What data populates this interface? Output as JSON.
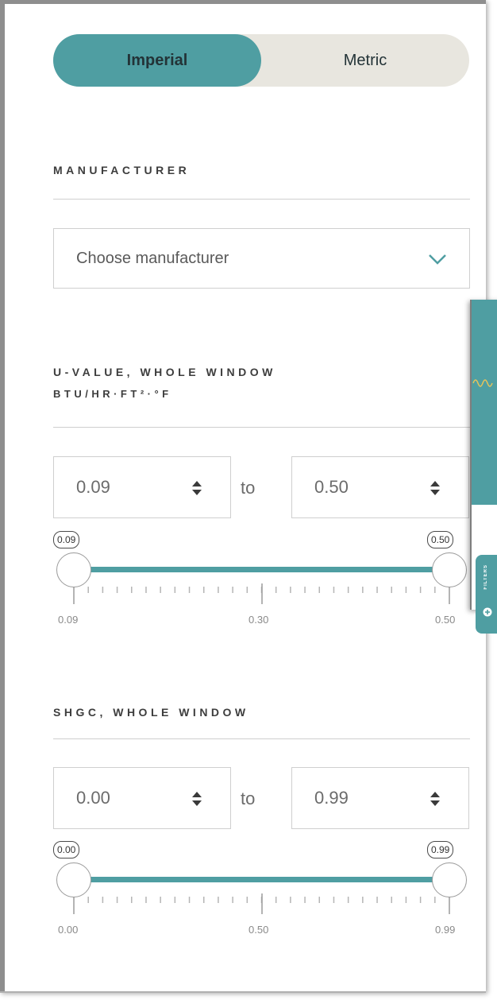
{
  "units_toggle": {
    "options": [
      "Imperial",
      "Metric"
    ],
    "selected": "Imperial"
  },
  "manufacturer": {
    "heading": "MANUFACTURER",
    "placeholder": "Choose manufacturer"
  },
  "u_value": {
    "heading_line1": "U-VALUE, WHOLE WINDOW",
    "heading_line2": "BTU/HR·FT²·°F",
    "min_input": "0.09",
    "to_word": "to",
    "max_input": "0.50",
    "bubble_min": "0.09",
    "bubble_max": "0.50",
    "scale_labels": [
      "0.09",
      "0.30",
      "0.50"
    ]
  },
  "shgc": {
    "heading": "SHGC, WHOLE WINDOW",
    "min_input": "0.00",
    "to_word": "to",
    "max_input": "0.99",
    "bubble_min": "0.00",
    "bubble_max": "0.99",
    "scale_labels": [
      "0.00",
      "0.50",
      "0.99"
    ]
  },
  "side_tab": {
    "label": "FILTERS"
  },
  "colors": {
    "accent": "#4f9ea2",
    "toggle_bg": "#e8e6df",
    "border": "#cfcfcf"
  }
}
